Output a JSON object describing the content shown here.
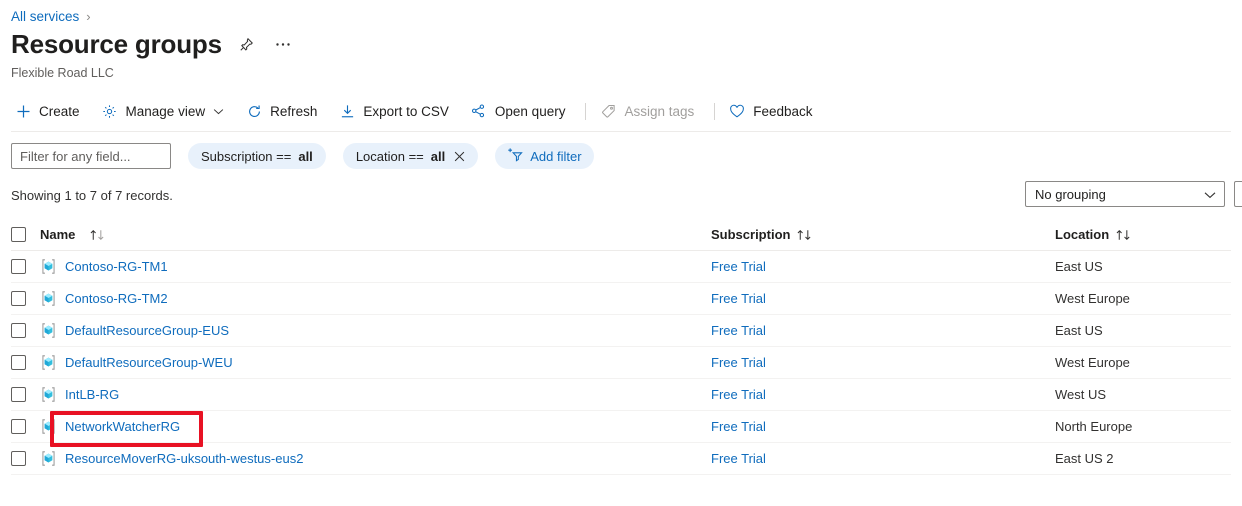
{
  "breadcrumb": {
    "root": "All services",
    "separator": "›"
  },
  "header": {
    "title": "Resource groups",
    "subtitle": "Flexible Road LLC",
    "pin_icon": "pin-icon",
    "more_icon": "ellipsis-icon"
  },
  "toolbar": {
    "create": "Create",
    "manage_view": "Manage view",
    "refresh": "Refresh",
    "export_csv": "Export to CSV",
    "open_query": "Open query",
    "assign_tags": "Assign tags",
    "assign_tags_disabled": true,
    "feedback": "Feedback"
  },
  "filters": {
    "search_placeholder": "Filter for any field...",
    "search_value": "",
    "pills": [
      {
        "label": "Subscription ==",
        "value": "all",
        "removable": false
      },
      {
        "label": "Location ==",
        "value": "all",
        "removable": true
      }
    ],
    "add_filter": "Add filter"
  },
  "status": {
    "records_text": "Showing 1 to 7 of 7 records."
  },
  "grouping": {
    "selected": "No grouping"
  },
  "table": {
    "columns": [
      {
        "key": "name",
        "label": "Name",
        "sortable": true
      },
      {
        "key": "subscription",
        "label": "Subscription",
        "sortable": true
      },
      {
        "key": "location",
        "label": "Location",
        "sortable": true
      }
    ],
    "rows": [
      {
        "name": "Contoso-RG-TM1",
        "subscription": "Free Trial",
        "location": "East US"
      },
      {
        "name": "Contoso-RG-TM2",
        "subscription": "Free Trial",
        "location": "West Europe"
      },
      {
        "name": "DefaultResourceGroup-EUS",
        "subscription": "Free Trial",
        "location": "East US"
      },
      {
        "name": "DefaultResourceGroup-WEU",
        "subscription": "Free Trial",
        "location": "West Europe"
      },
      {
        "name": "IntLB-RG",
        "subscription": "Free Trial",
        "location": "West US"
      },
      {
        "name": "NetworkWatcherRG",
        "subscription": "Free Trial",
        "location": "North Europe"
      },
      {
        "name": "ResourceMoverRG-uksouth-westus-eus2",
        "subscription": "Free Trial",
        "location": "East US 2"
      }
    ],
    "highlighted_row_name": "NetworkWatcherRG"
  },
  "colors": {
    "link": "#0f6cbd",
    "pill_bg": "#e8f1fb",
    "highlight": "#e81123",
    "text": "#323130",
    "icon_cyan": "#32bedd"
  }
}
